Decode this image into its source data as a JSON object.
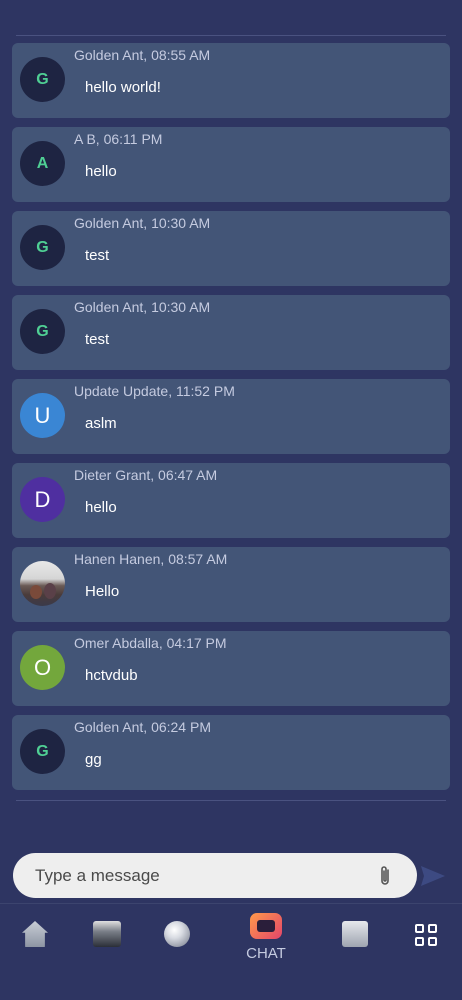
{
  "messages": [
    {
      "avatar_letter": "G",
      "avatar_style": "dark",
      "sender": "Golden Ant",
      "time": "08:55 AM",
      "text": "hello world!"
    },
    {
      "avatar_letter": "A",
      "avatar_style": "dark",
      "sender": "A B",
      "time": "06:11 PM",
      "text": "hello"
    },
    {
      "avatar_letter": "G",
      "avatar_style": "dark",
      "sender": "Golden Ant",
      "time": "10:30 AM",
      "text": "test"
    },
    {
      "avatar_letter": "G",
      "avatar_style": "dark",
      "sender": "Golden Ant",
      "time": "10:30 AM",
      "text": "test"
    },
    {
      "avatar_letter": "U",
      "avatar_style": "color",
      "avatar_color": "#3a86d4",
      "sender": "Update Update",
      "time": "11:52 PM",
      "text": "aslm"
    },
    {
      "avatar_letter": "D",
      "avatar_style": "color",
      "avatar_color": "#4f2fa0",
      "sender": "Dieter Grant",
      "time": "06:47 AM",
      "text": "hello"
    },
    {
      "avatar_letter": "",
      "avatar_style": "photo",
      "sender": "Hanen Hanen",
      "time": "08:57 AM",
      "text": "Hello"
    },
    {
      "avatar_letter": "O",
      "avatar_style": "color",
      "avatar_color": "#73a73c",
      "sender": "Omer Abdalla",
      "time": "04:17 PM",
      "text": "hctvdub"
    },
    {
      "avatar_letter": "G",
      "avatar_style": "dark",
      "sender": "Golden Ant",
      "time": "06:24 PM",
      "text": "gg"
    }
  ],
  "composer": {
    "placeholder": "Type a message",
    "attach_icon": "paperclip-icon",
    "send_icon": "send-icon"
  },
  "nav": {
    "items": [
      {
        "icon": "home-icon",
        "label": ""
      },
      {
        "icon": "team-icon",
        "label": ""
      },
      {
        "icon": "ball-icon",
        "label": ""
      },
      {
        "icon": "chat-icon",
        "label": "CHAT"
      },
      {
        "icon": "news-icon",
        "label": ""
      },
      {
        "icon": "grid-icon",
        "label": ""
      }
    ]
  },
  "colors": {
    "background": "#2e3562",
    "bubble": "#435577",
    "avatar_dark": "#1e2442",
    "avatar_letter": "#4fcf94"
  }
}
